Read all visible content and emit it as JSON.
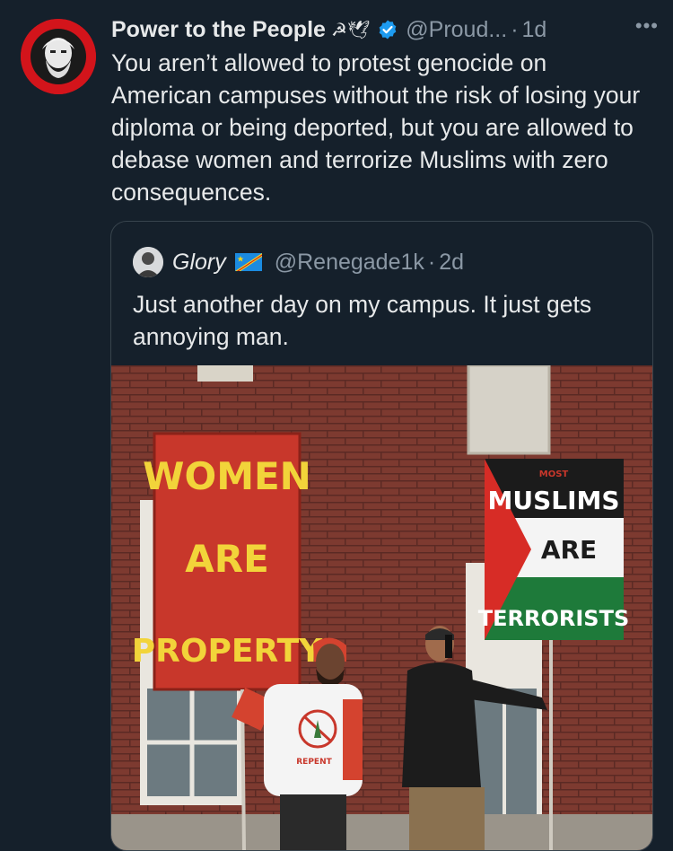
{
  "tweet": {
    "display_name": "Power to the People",
    "name_emojis": "☭🕊",
    "handle": "@Proud...",
    "separator": "·",
    "time": "1d",
    "more": "•••",
    "text": "You aren’t allowed to protest genocide on American campuses without the risk of losing your diploma or being deported, but you are allowed to debase women and terrorize Muslims with zero consequences."
  },
  "quote": {
    "display_name": "Glory",
    "handle": "@Renegade1k",
    "separator": "·",
    "time": "2d",
    "text": "Just another day on my campus. It just gets annoying man.",
    "photo": {
      "sign_left_lines": [
        "WOMEN",
        "ARE",
        "PROPERTY"
      ],
      "sign_right_lines": [
        "MOST",
        "MUSLIMS",
        "ARE",
        "TERRORISTS"
      ],
      "shirt_text": "REPENT"
    }
  },
  "colors": {
    "background": "#15202b",
    "text": "#e7e9ea",
    "muted": "#8b98a5",
    "verified": "#1d9bf0",
    "avatar_bg": "#d3141b"
  }
}
